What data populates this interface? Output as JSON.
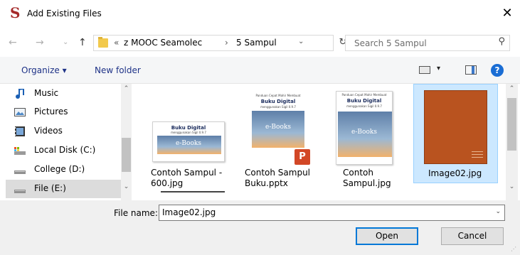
{
  "window": {
    "title": "Add Existing Files",
    "app_icon_glyph": "S",
    "close_glyph": "✕"
  },
  "nav": {
    "back_glyph": "←",
    "forward_glyph": "→",
    "recent_glyph": "⌄",
    "up_glyph": "↑"
  },
  "address": {
    "chevron": "«",
    "crumbs": [
      "z MOOC Seamolec",
      "5 Sampul"
    ],
    "separator": "›",
    "dropdown_glyph": "⌄",
    "refresh_glyph": "↻"
  },
  "search": {
    "placeholder": "Search 5 Sampul",
    "icon_glyph": "⚲"
  },
  "toolbar": {
    "organize_label": "Organize ▾",
    "new_folder_label": "New folder",
    "view_dropdown_glyph": "▾",
    "help_glyph": "?"
  },
  "sidebar": {
    "items": [
      {
        "label": "Music",
        "icon": "music-icon"
      },
      {
        "label": "Pictures",
        "icon": "pictures-icon"
      },
      {
        "label": "Videos",
        "icon": "videos-icon"
      },
      {
        "label": "Local Disk (C:)",
        "icon": "local-disk-icon"
      },
      {
        "label": "College (D:)",
        "icon": "drive-icon"
      },
      {
        "label": "File (E:)",
        "icon": "drive-icon",
        "selected": true
      }
    ],
    "scroll_up_glyph": "⌃",
    "scroll_down_glyph": "⌄"
  },
  "files": [
    {
      "name": "Contoh Sampul -\n600.jpg",
      "thumb_title": "Buku Digital",
      "thumb_sub": "menggunakan Sigil 0.9.7",
      "ebook_text": "e-Books"
    },
    {
      "name": "Contoh Sampul\nBuku.pptx",
      "thumb_header": "Panduan Cepat Mahir Membuat",
      "thumb_title": "Buku Digital",
      "thumb_sub": "menggunakan Sigil 0.9.7",
      "ebook_text": "e-Books",
      "badge": "P"
    },
    {
      "name": "Contoh\nSampul.jpg",
      "thumb_header": "Panduan Cepat Mahir Membuat",
      "thumb_title": "Buku Digital",
      "thumb_sub": "menggunakan Sigil 0.9.7",
      "ebook_text": "e-Books"
    },
    {
      "name": "Image02.jpg",
      "selected": true,
      "cover_color": "#b9531f"
    }
  ],
  "content_scroll": {
    "up_glyph": "⌃",
    "down_glyph": "⌄"
  },
  "filename": {
    "label": "File name:",
    "value": "Image02.jpg",
    "dropdown_glyph": "⌄"
  },
  "buttons": {
    "open": "Open",
    "cancel": "Cancel"
  },
  "colors": {
    "selection": "#cce8ff",
    "accent": "#0078d7",
    "link": "#1e3287"
  }
}
